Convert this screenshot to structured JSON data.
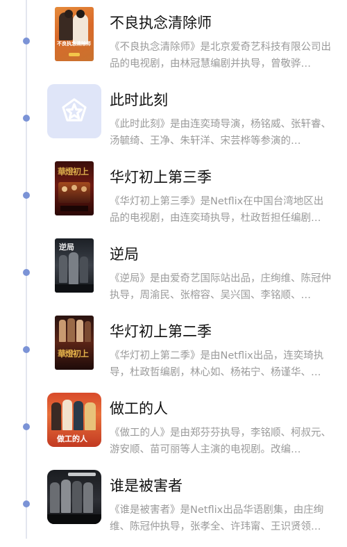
{
  "items": [
    {
      "title": "不良执念清除师",
      "description": "《不良执念清除师》是北京爱奇艺科技有限公司出品的电视剧，由林冠慧编剧并执导，曾敬骅…",
      "poster_text": "不良执念清除师",
      "thumb_icon": "poster-image"
    },
    {
      "title": "此时此刻",
      "description": "《此时此刻》是由连奕琦导演，杨铭威、张轩睿、汤毓绮、王净、朱轩洋、宋芸桦等参演的…",
      "thumb_icon": "pentagon-star-placeholder-icon"
    },
    {
      "title": "华灯初上第三季",
      "description": "《华灯初上第三季》是Netflix在中国台湾地区出品的电视剧，由连奕琦执导，杜政哲担任编剧…",
      "poster_text": "華燈初上",
      "thumb_icon": "poster-image"
    },
    {
      "title": "逆局",
      "description": "《逆局》是由爱奇艺国际站出品，庄绚维、陈冠仲执导，周渝民、张榕容、吴兴国、李铭顺、…",
      "poster_text": "逆局",
      "thumb_icon": "poster-image"
    },
    {
      "title": "华灯初上第二季",
      "description": "《华灯初上第二季》是由Netflix出品，连奕琦执导，杜政哲编剧，林心如、杨祐宁、杨谨华、…",
      "poster_text": "華燈初上",
      "thumb_icon": "poster-image"
    },
    {
      "title": "做工的人",
      "description": "《做工的人》是由郑芬芬执导，李铭顺、柯叔元、游安顺、苗可丽等人主演的电视剧。改编…",
      "poster_text": "做工的人",
      "thumb_icon": "poster-image"
    },
    {
      "title": "谁是被害者",
      "description": "《谁是被害者》是Netflix出品华语剧集，由庄绚维、陈冠仲执导，张孝全、许玮甯、王识贤领…",
      "thumb_icon": "poster-image"
    }
  ],
  "colors": {
    "timeline_dot": "#7b93d6",
    "timeline_line": "#e3e6ef",
    "title_text": "#111111",
    "description_text": "#9a9a9a",
    "placeholder_bg": "#dfe5f8"
  }
}
